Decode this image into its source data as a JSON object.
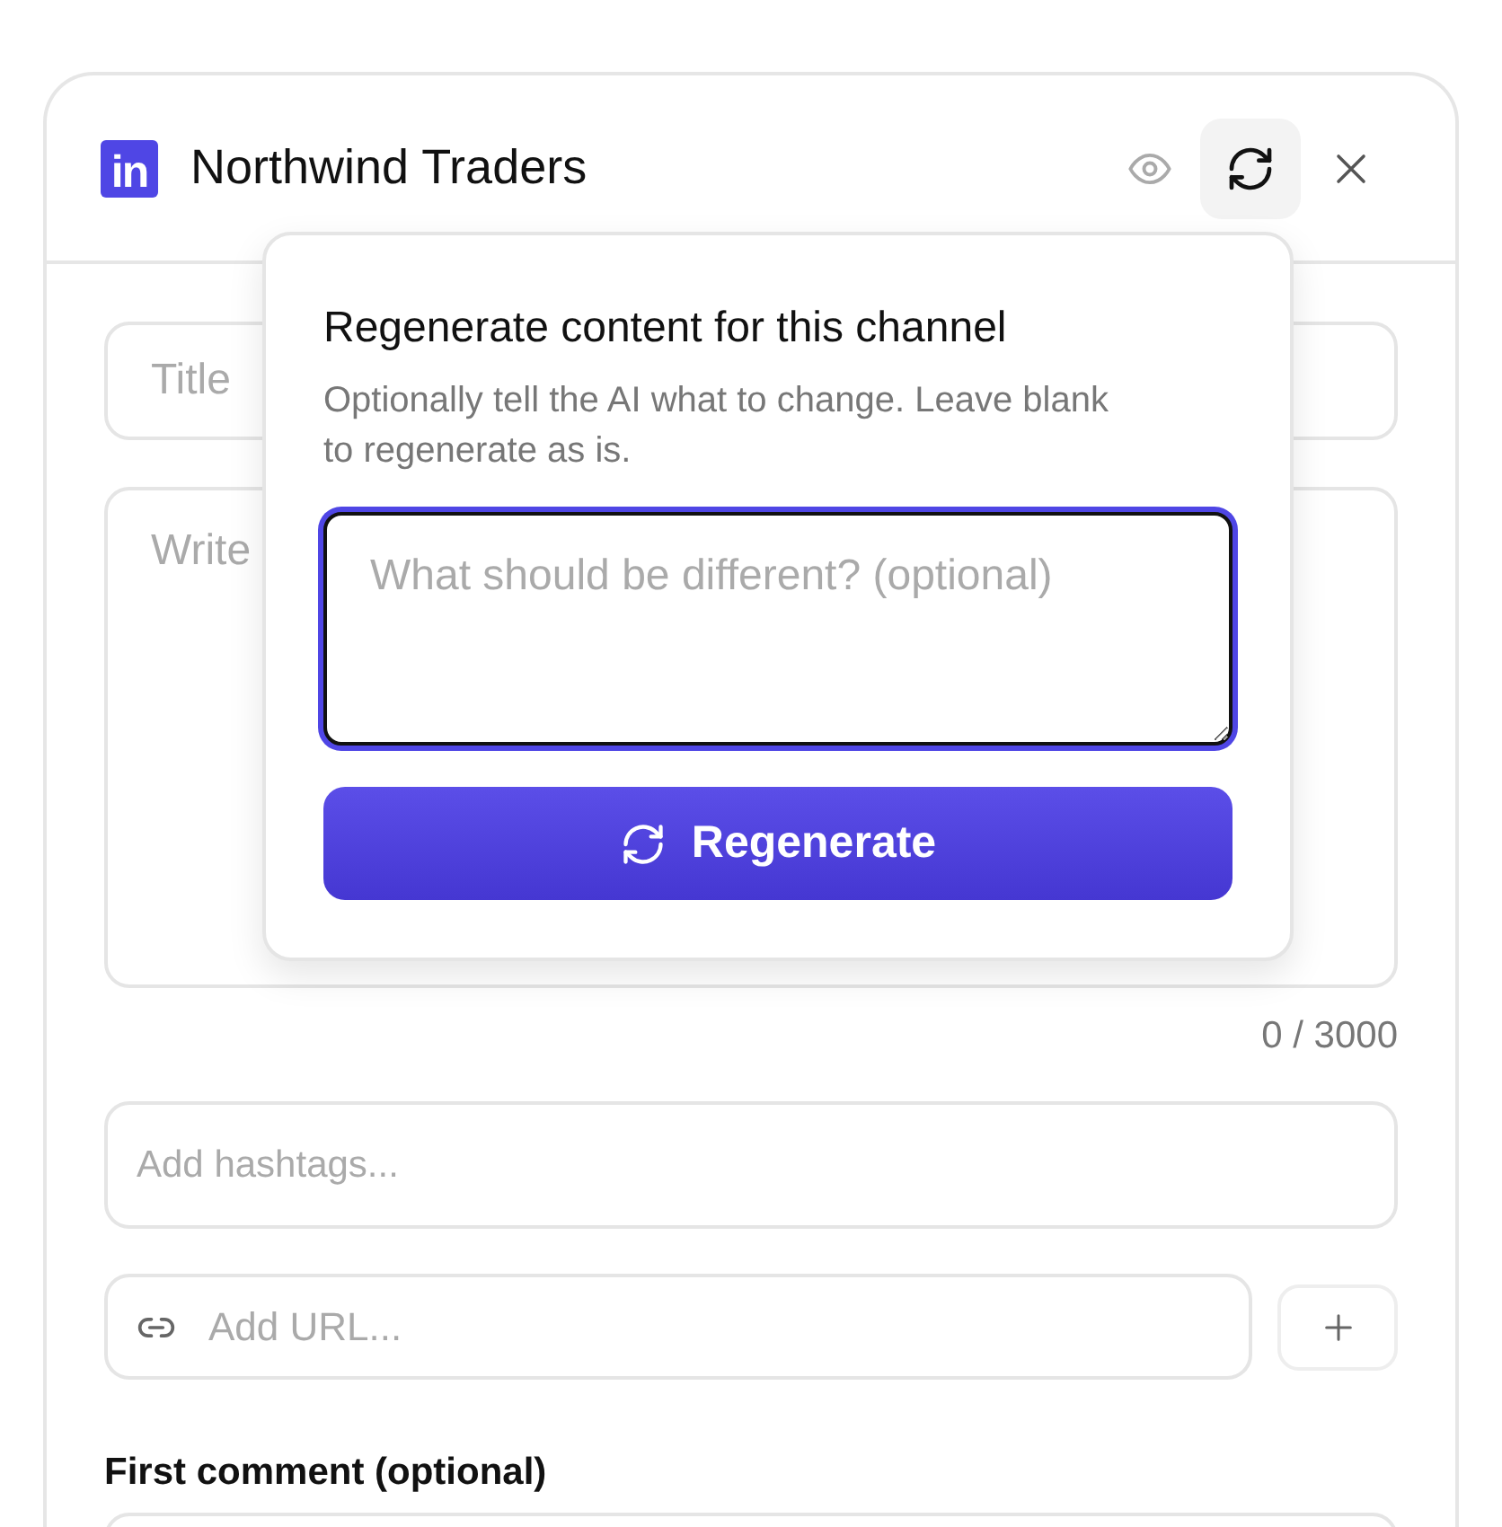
{
  "header": {
    "logo_text": "in",
    "title": "Northwind Traders",
    "actions": [
      {
        "kind": "preview",
        "selected": false
      },
      {
        "kind": "regenerate",
        "selected": true
      },
      {
        "kind": "close",
        "selected": false
      }
    ]
  },
  "form": {
    "title_field": {
      "placeholder": "Title"
    },
    "body_field": {
      "placeholder": "Write"
    },
    "char_count": "0 / 3000",
    "hashtags_field": {
      "placeholder": "Add hashtags..."
    },
    "url_field": {
      "placeholder": "Add URL..."
    },
    "first_comment_label": "First comment (optional)"
  },
  "popover": {
    "title": "Regenerate content for this channel",
    "description": "Optionally tell the AI what to change. Leave blank to regenerate as is.",
    "prompt_field": {
      "placeholder": "What should be different? (optional)",
      "focused": true
    },
    "button": "Regenerate"
  }
}
